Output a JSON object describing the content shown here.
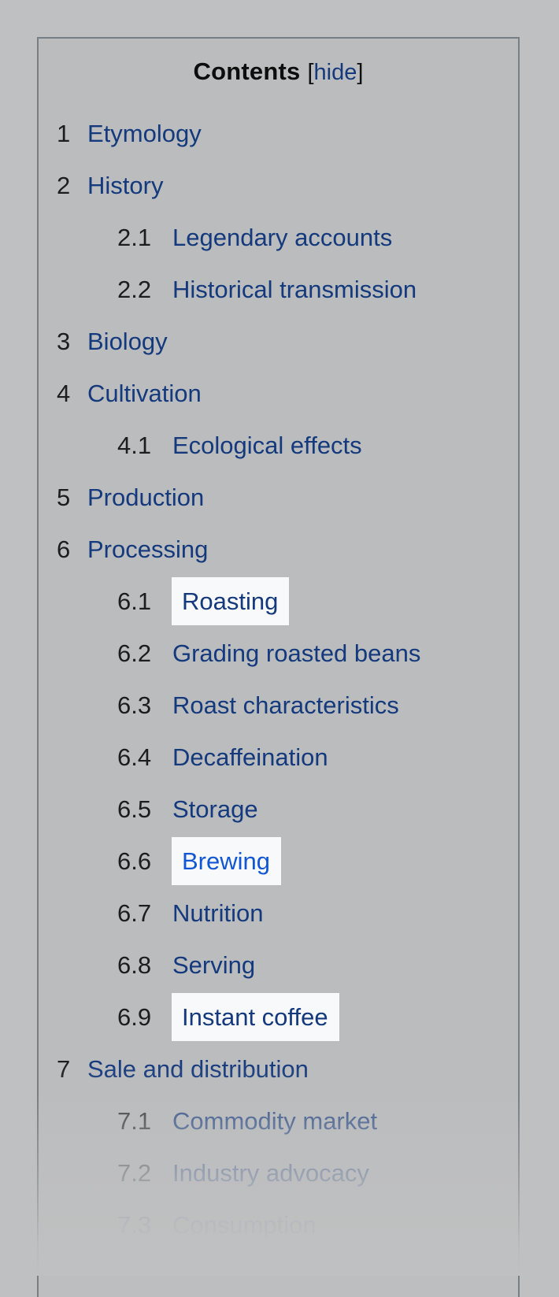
{
  "panel": {
    "title": "Contents",
    "toggle_open_bracket": "[",
    "toggle_label": "hide",
    "toggle_close_bracket": "]",
    "background_color": "#babcbd",
    "border_color": "#777e85",
    "page_background_color": "#bfc0c1",
    "link_color": "#14397d",
    "active_link_color": "#1157d4",
    "highlight_color": "#f8f9fa"
  },
  "toc": {
    "items": [
      {
        "number": "1",
        "label": "Etymology",
        "level": 1,
        "highlighted": false,
        "active": false
      },
      {
        "number": "2",
        "label": "History",
        "level": 1,
        "highlighted": false,
        "active": false
      },
      {
        "number": "2.1",
        "label": "Legendary accounts",
        "level": 2,
        "highlighted": false,
        "active": false
      },
      {
        "number": "2.2",
        "label": "Historical transmission",
        "level": 2,
        "highlighted": false,
        "active": false
      },
      {
        "number": "3",
        "label": "Biology",
        "level": 1,
        "highlighted": false,
        "active": false
      },
      {
        "number": "4",
        "label": "Cultivation",
        "level": 1,
        "highlighted": false,
        "active": false
      },
      {
        "number": "4.1",
        "label": "Ecological effects",
        "level": 2,
        "highlighted": false,
        "active": false
      },
      {
        "number": "5",
        "label": "Production",
        "level": 1,
        "highlighted": false,
        "active": false
      },
      {
        "number": "6",
        "label": "Processing",
        "level": 1,
        "highlighted": false,
        "active": false
      },
      {
        "number": "6.1",
        "label": "Roasting",
        "level": 2,
        "highlighted": true,
        "active": false
      },
      {
        "number": "6.2",
        "label": "Grading roasted beans",
        "level": 2,
        "highlighted": false,
        "active": false
      },
      {
        "number": "6.3",
        "label": "Roast characteristics",
        "level": 2,
        "highlighted": false,
        "active": false
      },
      {
        "number": "6.4",
        "label": "Decaffeination",
        "level": 2,
        "highlighted": false,
        "active": false
      },
      {
        "number": "6.5",
        "label": "Storage",
        "level": 2,
        "highlighted": false,
        "active": false
      },
      {
        "number": "6.6",
        "label": "Brewing",
        "level": 2,
        "highlighted": true,
        "active": true
      },
      {
        "number": "6.7",
        "label": "Nutrition",
        "level": 2,
        "highlighted": false,
        "active": false
      },
      {
        "number": "6.8",
        "label": "Serving",
        "level": 2,
        "highlighted": false,
        "active": false
      },
      {
        "number": "6.9",
        "label": "Instant coffee",
        "level": 2,
        "highlighted": true,
        "active": false
      },
      {
        "number": "7",
        "label": "Sale and distribution",
        "level": 1,
        "highlighted": false,
        "active": false
      },
      {
        "number": "7.1",
        "label": "Commodity market",
        "level": 2,
        "highlighted": false,
        "active": false
      },
      {
        "number": "7.2",
        "label": "Industry advocacy",
        "level": 2,
        "highlighted": false,
        "active": false
      },
      {
        "number": "7.3",
        "label": "Consumption",
        "level": 2,
        "highlighted": false,
        "active": false
      }
    ]
  }
}
